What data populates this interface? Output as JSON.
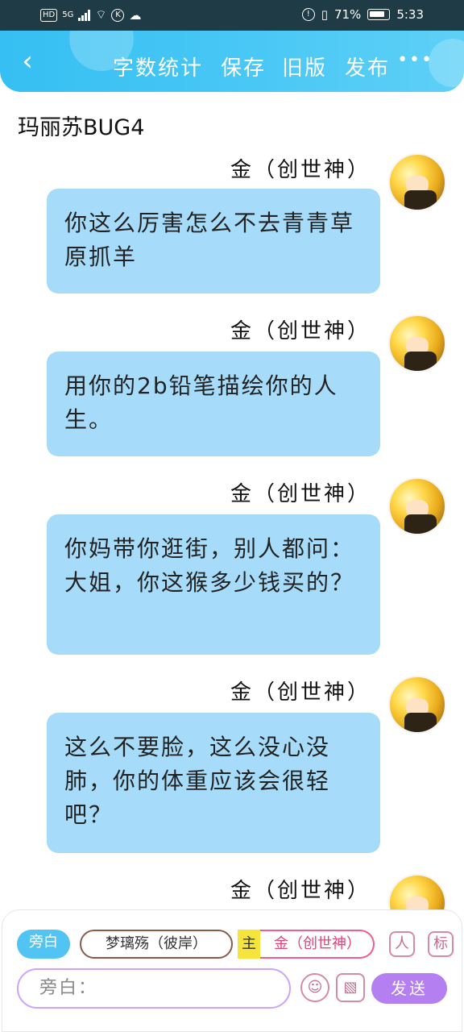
{
  "status_bar": {
    "hd": "HD",
    "network": "5G",
    "notify_k": "K",
    "battery_percent": "71%",
    "time": "5:33"
  },
  "header": {
    "back_icon": "chevron-left-icon",
    "menu": [
      "字数统计",
      "保存",
      "旧版",
      "发布"
    ],
    "more_label": "•••"
  },
  "chat": {
    "title": "玛丽苏BUG4",
    "messages": [
      {
        "speaker": "金（创世神）",
        "text": "你这么厉害怎么不去青青草原抓羊"
      },
      {
        "speaker": "金（创世神）",
        "text": "用你的2b铅笔描绘你的人生。"
      },
      {
        "speaker": "金（创世神）",
        "text": "你妈带你逛街，别人都问：大姐，你这猴多少钱买的？"
      },
      {
        "speaker": "金（创世神）",
        "text": "这么不要脸，这么没心没肺，你的体重应该会很轻吧？"
      },
      {
        "speaker": "金（创世神）",
        "text": ""
      }
    ]
  },
  "composer": {
    "aside_chip": "旁白",
    "role_chip_1": "梦璃殇（彼岸）",
    "main_tag": "主",
    "role_chip_2": "金（创世神）",
    "icon_person_label": "人",
    "icon_tag_label": "标",
    "input_placeholder": "旁白：",
    "emoji_icon": "☺",
    "image_icon": "▧",
    "send_label": "发送"
  }
}
